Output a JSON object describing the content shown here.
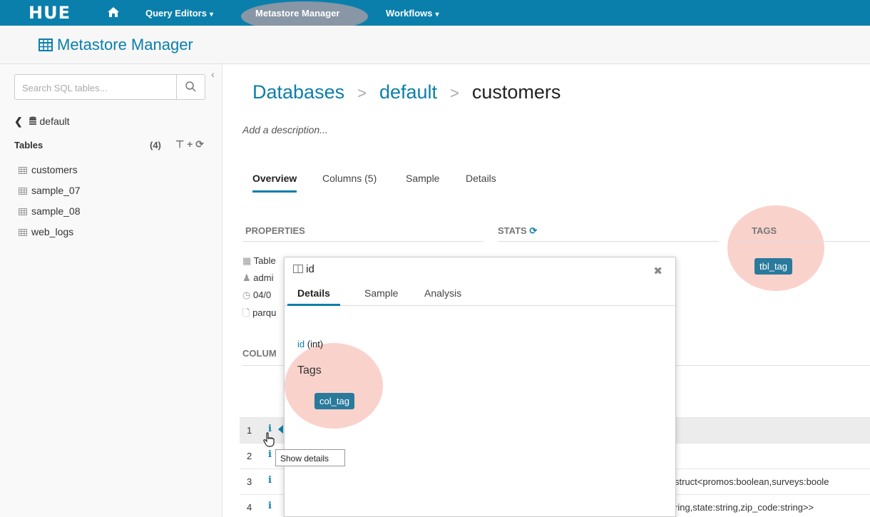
{
  "topbar": {
    "logo": "HUE",
    "nav": [
      {
        "label": "Query Editors",
        "dropdown": true
      },
      {
        "label": "Metastore Manager",
        "dropdown": false
      },
      {
        "label": "Workflows",
        "dropdown": true
      }
    ]
  },
  "page_title": "Metastore Manager",
  "sidebar": {
    "search_placeholder": "Search SQL tables...",
    "database": "default",
    "tables_label": "Tables",
    "tables_count": "(4)",
    "tables": [
      "customers",
      "sample_07",
      "sample_08",
      "web_logs"
    ]
  },
  "breadcrumb": {
    "databases": "Databases",
    "database": "default",
    "table": "customers",
    "separator": ">"
  },
  "description_placeholder": "Add a description...",
  "tabs": [
    "Overview",
    "Columns (5)",
    "Sample",
    "Details"
  ],
  "sections": {
    "properties": "PROPERTIES",
    "stats": "STATS",
    "tags": "TAGS",
    "columns": "COLUM"
  },
  "properties": [
    "Table",
    "admi",
    "04/0",
    "parqu"
  ],
  "table_tag": "tbl_tag",
  "rows": [
    {
      "n": "1",
      "type": ""
    },
    {
      "n": "2",
      "type": ""
    },
    {
      "n": "3",
      "type": "struct<promos:boolean,surveys:boole"
    },
    {
      "n": "4",
      "type": "ring,state:string,zip_code:string>>"
    }
  ],
  "popover": {
    "title": "id",
    "tabs": [
      "Details",
      "Sample",
      "Analysis"
    ],
    "column_name": "id",
    "column_type": "(int)",
    "tags_label": "Tags",
    "tag": "col_tag"
  },
  "tooltip": "Show details",
  "colors": {
    "brand": "#0b7fab",
    "badge": "#2a7a9c",
    "highlight": "#f6b4aa"
  }
}
